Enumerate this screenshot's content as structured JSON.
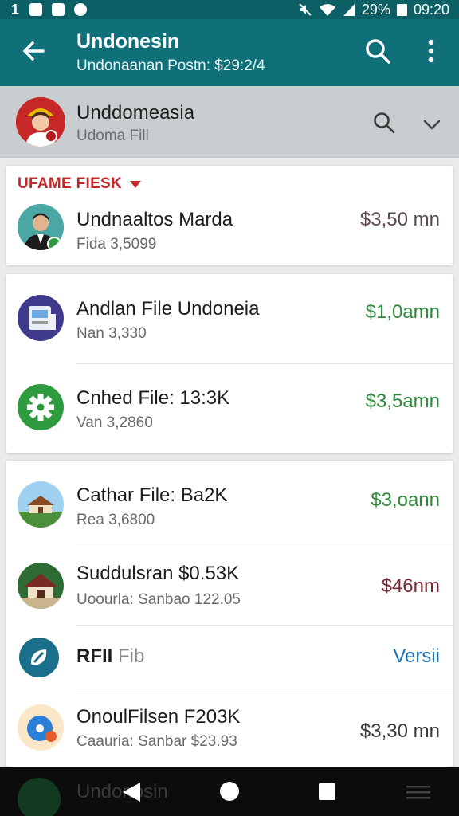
{
  "status_bar": {
    "left_text": "1",
    "battery": "29%",
    "time": "09:20"
  },
  "app_bar": {
    "title": "Undonesin",
    "subtitle": "Undonaanan Postn: $29:2/4"
  },
  "profile": {
    "name": "Unddomeasia",
    "subtitle": "Udoma Fill"
  },
  "section": {
    "header": "UFAME FIESK"
  },
  "group1": [
    {
      "title": "Undnaaltos Marda",
      "sub": "Fida 3,5099",
      "amount": "$3,50 mn",
      "amount_color": "#5d4a4a",
      "icon": "person-avatar-icon"
    }
  ],
  "group2": [
    {
      "title": "Andlan File Undoneia",
      "sub": "Nan 3,330",
      "amount": "$1,0amn",
      "amount_color": "#2e8b3d",
      "icon": "document-machine-icon"
    },
    {
      "title": "Cnhed File: 13:3K",
      "sub": "Van 3,2860",
      "amount": "$3,5amn",
      "amount_color": "#2e8b3d",
      "icon": "gear-icon"
    }
  ],
  "group3": [
    {
      "title": "Cathar File: Ba2K",
      "sub": "Rea 3,6800",
      "amount": "$3,oann",
      "amount_color": "#2e8b3d",
      "icon": "house-landscape-icon"
    },
    {
      "title": "Suddulsran $0.53K",
      "sub": "Uoourla: Sanbao 122.05",
      "amount": "$46nm",
      "amount_color": "#7b2a35",
      "icon": "temple-icon"
    }
  ],
  "rfii": {
    "bold": "RFII",
    "light": "Fib",
    "action": "Versii",
    "action_color": "#1a73b8"
  },
  "group4": [
    {
      "title": "OnoulFilsen F203K",
      "sub": "Caauria: Sanbar $23.93",
      "amount": "$3,30 mn",
      "amount_color": "#3b3b3b",
      "icon": "music-disc-icon"
    }
  ],
  "nav_peek": {
    "title": "Undonosin"
  },
  "colors": {
    "app_bar": "#0f7079",
    "status_bar": "#0d5f66",
    "accent_red": "#c62828",
    "green": "#2e8b3d"
  }
}
